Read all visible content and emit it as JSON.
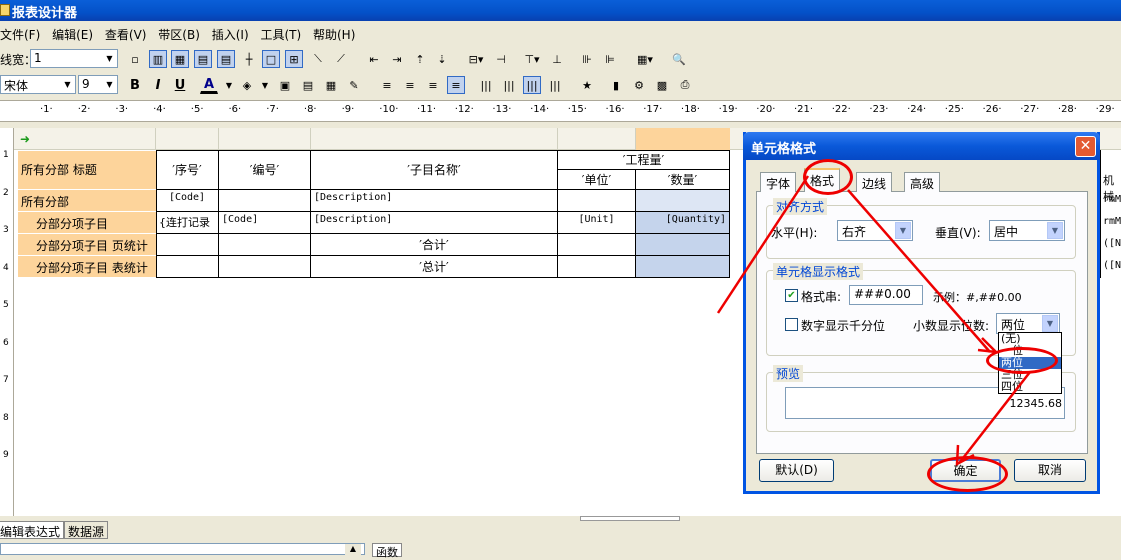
{
  "app": {
    "title": "报表设计器"
  },
  "menu": [
    "文件(F)",
    "编辑(E)",
    "查看(V)",
    "带区(B)",
    "插入(I)",
    "工具(T)",
    "帮助(H)"
  ],
  "toolbar": {
    "linewidth_label": "线宽：",
    "linewidth_value": "1",
    "font_name": "宋体",
    "font_size": "9",
    "bold": "B",
    "italic": "I",
    "underline": "U",
    "font_color": "A"
  },
  "ruler": {
    "numbers": [
      "1",
      "2",
      "3",
      "4",
      "5",
      "6",
      "7",
      "8",
      "9",
      "10",
      "11",
      "12",
      "13",
      "14",
      "15",
      "16",
      "17",
      "18",
      "19",
      "20",
      "21",
      "22",
      "23",
      "24",
      "25",
      "26",
      "27",
      "28",
      "29"
    ]
  },
  "vruler": {
    "numbers": [
      "1",
      "2",
      "3",
      "4",
      "5",
      "6",
      "7",
      "8",
      "9"
    ]
  },
  "report": {
    "bands": [
      "所有分部 标题",
      "所有分部",
      "分部分项子目",
      "分部分项子目 页统计",
      "分部分项子目 表统计"
    ],
    "header": {
      "seq": "′序号′",
      "code": "′编号′",
      "name": "′子目名称′",
      "quantity_group": "′工程量′",
      "unit": "′单位′",
      "amount": "′数量′"
    },
    "row1": {
      "seq": "[Code]",
      "name": "[Description]"
    },
    "row2": {
      "seq": "{连打记录",
      "code": "[Code]",
      "name": "[Description]",
      "unit": "[Unit]",
      "amount": "[Quantity]"
    },
    "row3": {
      "label": "′合计′"
    },
    "row4": {
      "label": "′总计′"
    },
    "right_fragments": [
      "机械",
      "rmM",
      "rmM",
      "([N",
      "([N"
    ]
  },
  "bottom": {
    "tabs": [
      "编辑表达式",
      "数据源"
    ],
    "function_tab": "函数"
  },
  "dialog": {
    "title": "单元格格式",
    "close": "✕",
    "tabs": [
      "字体",
      "格式",
      "边线",
      "高级"
    ],
    "alignment": {
      "group": "对齐方式",
      "horizontal_label": "水平(H):",
      "horizontal_value": "右齐",
      "vertical_label": "垂直(V):",
      "vertical_value": "居中"
    },
    "display": {
      "group": "单元格显示格式",
      "format_checkbox": "格式串:",
      "format_checked": true,
      "format_value": "###0.00",
      "example": "示例：#,##0.00",
      "thousands_label": "数字显示千分位",
      "thousands_checked": false,
      "decimals_label": "小数显示位数:",
      "decimals_value": "两位",
      "decimals_options": [
        "(无)",
        "一位",
        "两位",
        "三位",
        "四位"
      ],
      "decimals_selected_index": 2
    },
    "preview": {
      "group": "预览",
      "value": "12345.68"
    },
    "buttons": {
      "default": "默认(D)",
      "ok": "确定",
      "cancel": "取消"
    }
  },
  "colors": {
    "band": "#fdd49b",
    "selected_cell": "#c5d4ec",
    "annotation": "#e00000",
    "dialog_border": "#0054e3"
  }
}
